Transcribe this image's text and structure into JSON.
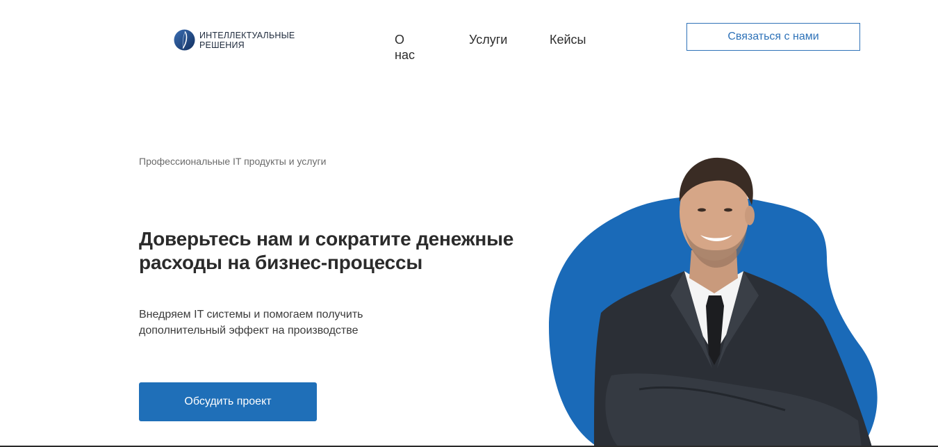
{
  "brand": {
    "line1": "ИНТЕЛЛЕКТУАЛЬНЫЕ",
    "line2": "РЕШЕНИЯ",
    "logo_icon": "feather-circle-logo"
  },
  "nav": {
    "items": [
      {
        "label": "О нас"
      },
      {
        "label": "Услуги"
      },
      {
        "label": "Кейсы"
      }
    ]
  },
  "header": {
    "contact_label": "Связаться с нами"
  },
  "hero": {
    "eyebrow": "Профессиональные IT продукты и услуги",
    "headline": "Доверьтесь нам и сократите денежные расходы на бизнес-процессы",
    "subtext": "Внедряем IT системы и помогаем получить дополнительный эффект на производстве",
    "cta_label": "Обсудить проект",
    "image_icon": "businessman-photo"
  },
  "colors": {
    "accent": "#1f6fb8",
    "accent_outline": "#2e72b8",
    "blob": "#1a6ab8",
    "text_dark": "#2b2b2b"
  }
}
